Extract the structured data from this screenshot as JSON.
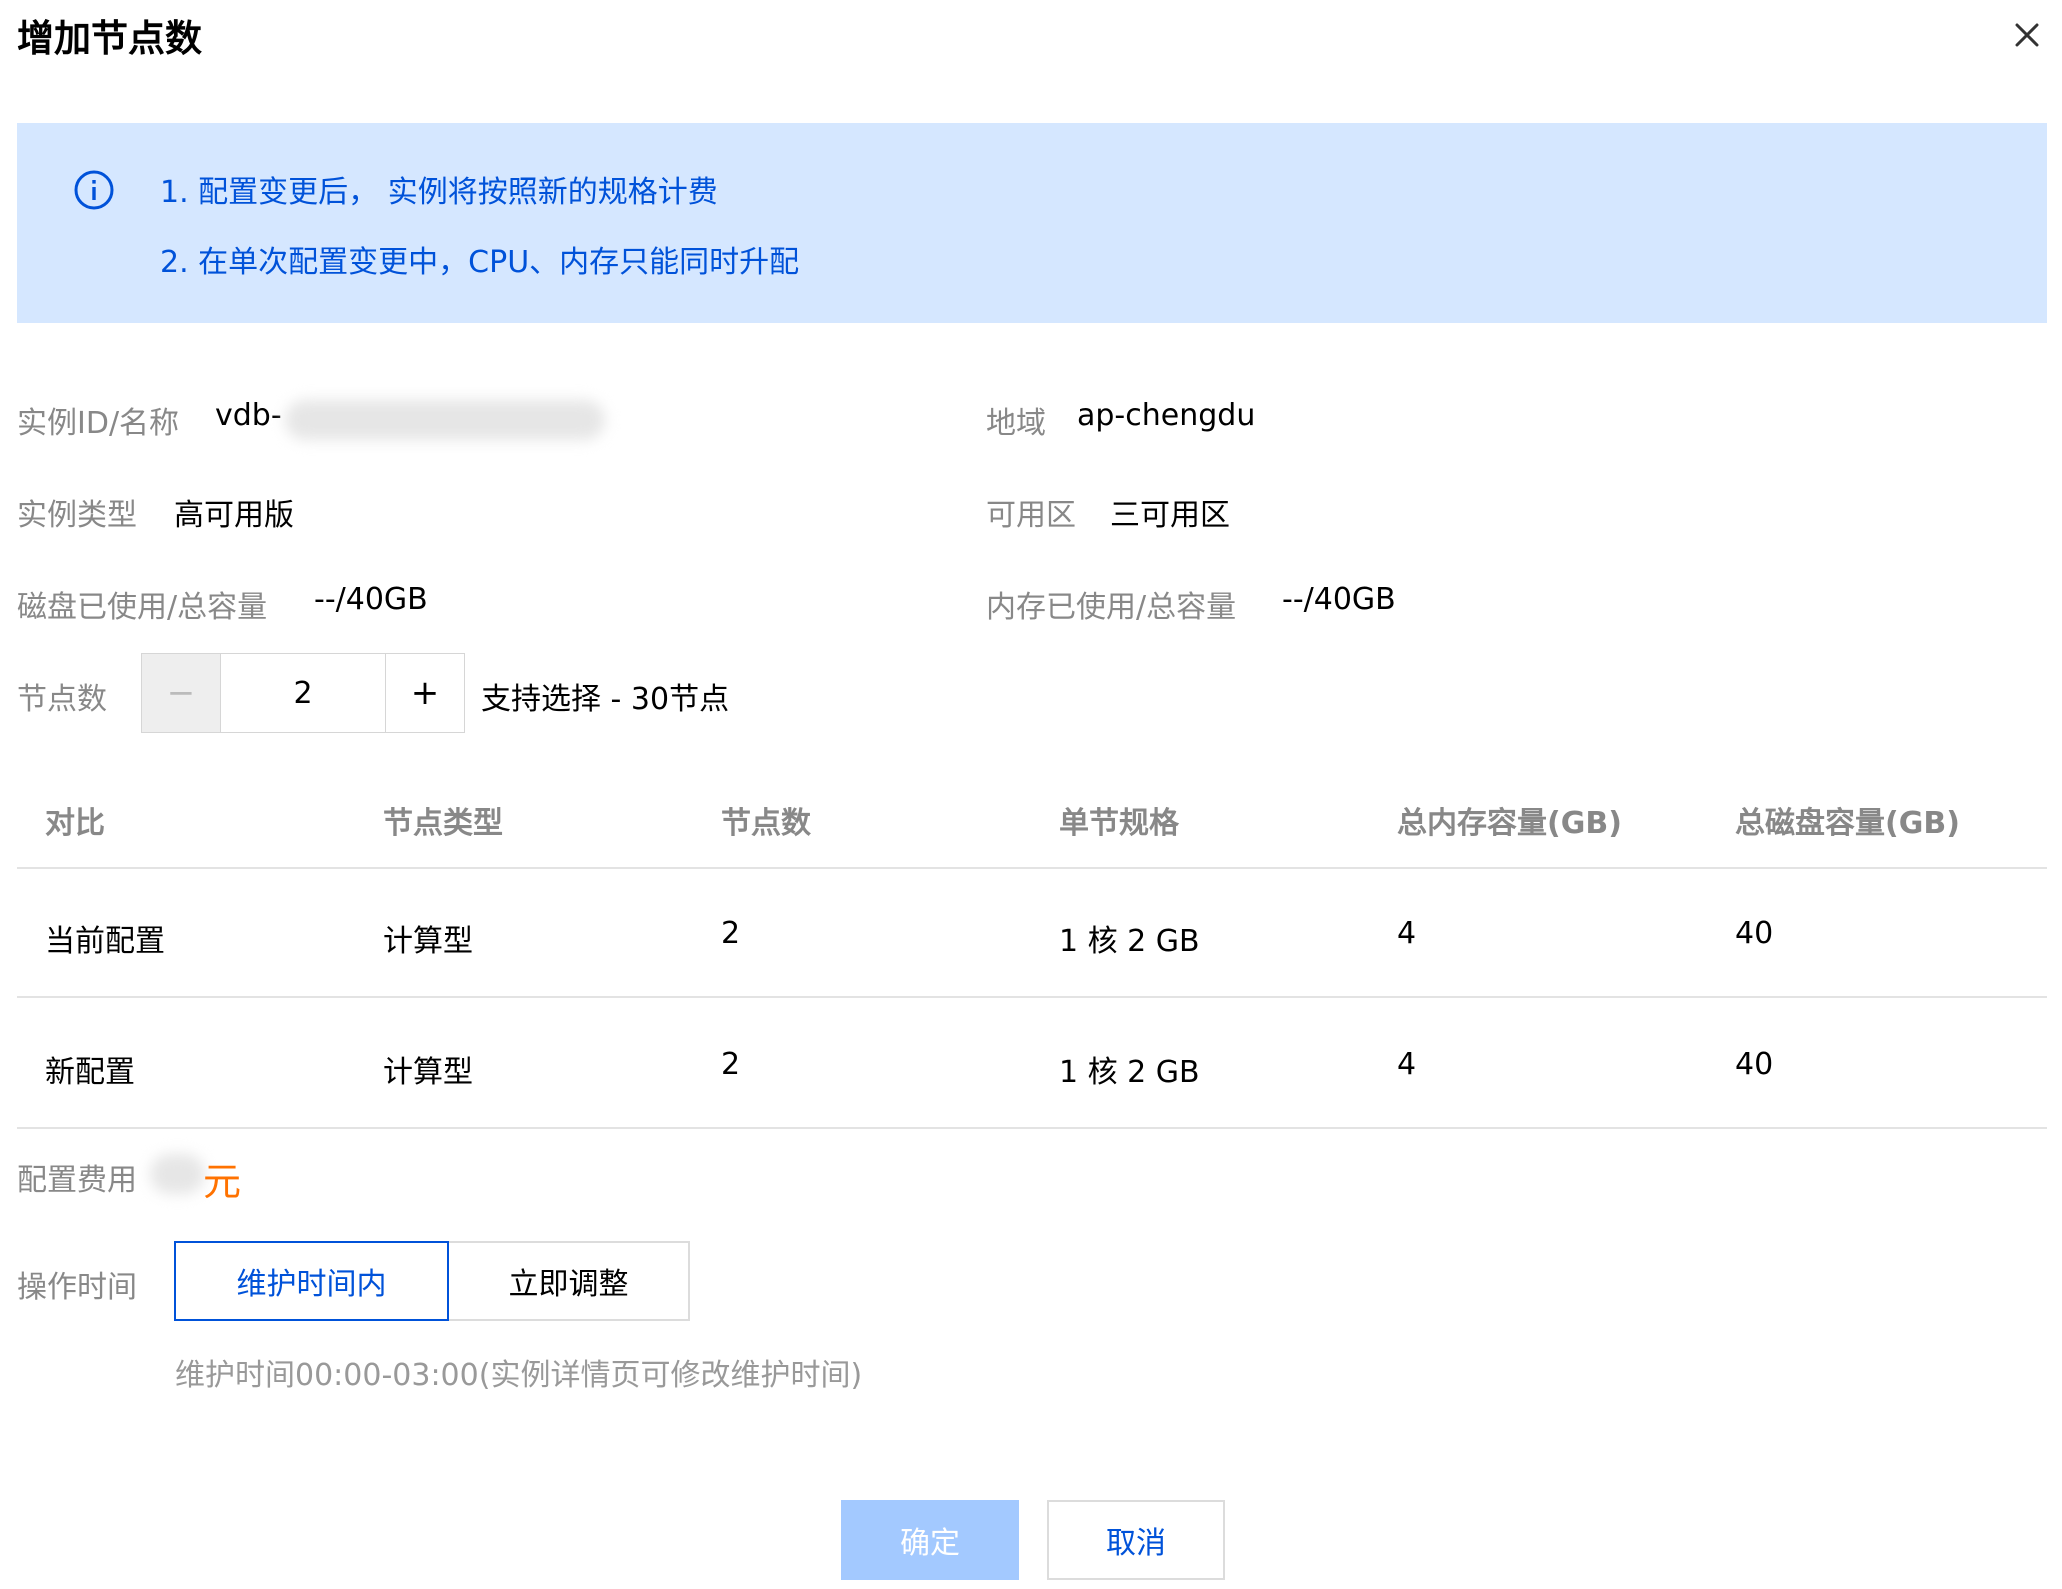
{
  "dialog": {
    "title": "增加节点数"
  },
  "notice": {
    "line1": "1. 配置变更后， 实例将按照新的规格计费",
    "line2": "2. 在单次配置变更中，CPU、内存只能同时升配"
  },
  "info": {
    "instance_id_label": "实例ID/名称",
    "instance_id_value": "vdb-",
    "region_label": "地域",
    "region_value": "ap-chengdu",
    "type_label": "实例类型",
    "type_value": "高可用版",
    "zone_label": "可用区",
    "zone_value": "三可用区",
    "disk_label": "磁盘已使用/总容量",
    "disk_value": "--/40GB",
    "memory_label": "内存已使用/总容量",
    "memory_value": "--/40GB"
  },
  "nodes": {
    "label": "节点数",
    "minus": "−",
    "value": "2",
    "plus": "+",
    "hint": "支持选择 - 30节点"
  },
  "table": {
    "headers": [
      "对比",
      "节点类型",
      "节点数",
      "单节规格",
      "总内存容量(GB)",
      "总磁盘容量(GB)"
    ],
    "rows": [
      [
        "当前配置",
        "计算型",
        "2",
        "1 核 2 GB",
        "4",
        "40"
      ],
      [
        "新配置",
        "计算型",
        "2",
        "1 核 2 GB",
        "4",
        "40"
      ]
    ]
  },
  "fee": {
    "label": "配置费用",
    "unit": "元"
  },
  "operation": {
    "label": "操作时间",
    "options": [
      "维护时间内",
      "立即调整"
    ],
    "selected": "维护时间内",
    "hint": "维护时间00:00-03:00(实例详情页可修改维护时间)"
  },
  "footer": {
    "confirm": "确定",
    "cancel": "取消"
  },
  "colors": {
    "primary": "#0052d9",
    "notice_bg": "#d5e7ff",
    "fee": "#ff7200",
    "confirm_disabled": "#a3c9ff"
  }
}
